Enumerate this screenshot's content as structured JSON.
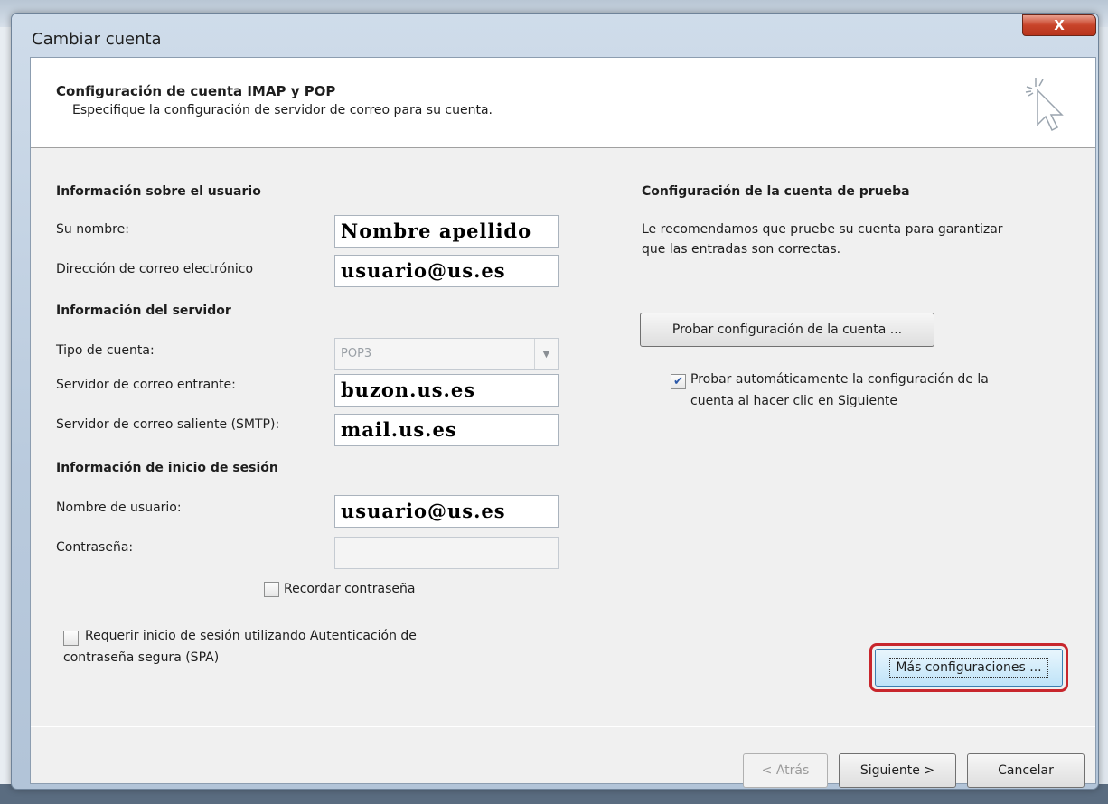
{
  "window": {
    "title": "Cambiar cuenta",
    "close_label": "X"
  },
  "header": {
    "title": "Configuración de cuenta IMAP y POP",
    "subtitle": "Especifique la configuración de servidor de correo para su cuenta."
  },
  "user_info": {
    "section_title": "Información sobre el usuario",
    "name_label": "Su nombre:",
    "name_value": "Nombre apellido",
    "email_label": "Dirección de correo electrónico",
    "email_value": "usuario@us.es"
  },
  "server_info": {
    "section_title": "Información del servidor",
    "account_type_label": "Tipo de cuenta:",
    "account_type_value": "POP3",
    "incoming_label": "Servidor de correo entrante:",
    "incoming_value": "buzon.us.es",
    "outgoing_label": "Servidor de correo saliente (SMTP):",
    "outgoing_value": "mail.us.es"
  },
  "login_info": {
    "section_title": "Información de inicio de sesión",
    "username_label": "Nombre de usuario:",
    "username_value": "usuario@us.es",
    "password_label": "Contraseña:",
    "password_value": "",
    "remember_label": "Recordar contraseña",
    "remember_checked": false,
    "spa_label_line1": "Requerir inicio de sesión utilizando Autenticación de",
    "spa_label_line2": "contraseña segura (SPA)",
    "spa_checked": false
  },
  "test": {
    "section_title": "Configuración de la cuenta de prueba",
    "description_line1": "Le recomendamos que pruebe su cuenta para garantizar",
    "description_line2": "que las entradas son correctas.",
    "test_button": "Probar configuración de la cuenta ...",
    "auto_test_line1": "Probar automáticamente la configuración de la",
    "auto_test_line2": "cuenta al hacer clic en Siguiente",
    "auto_test_checked": true
  },
  "more_settings_button": "Más configuraciones ...",
  "footer": {
    "back_button": "< Atrás",
    "next_button": "Siguiente >",
    "cancel_button": "Cancelar"
  },
  "colors": {
    "highlight": "#c8262c",
    "close": "#c8442a",
    "check": "#2b58a8"
  },
  "icons": {
    "header_icon": "cursor-sparkle-icon",
    "dropdown": "chevron-down-icon",
    "check": "checkmark-icon",
    "close": "close-icon"
  }
}
